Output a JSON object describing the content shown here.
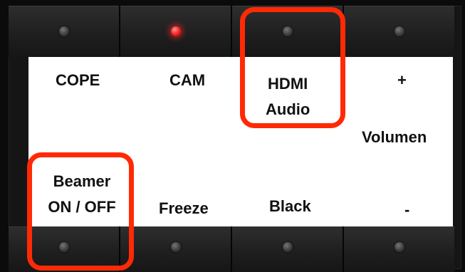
{
  "top_buttons": [
    {
      "name": "top-button-1",
      "led": "off"
    },
    {
      "name": "top-button-2",
      "led": "on"
    },
    {
      "name": "top-button-3",
      "led": "off"
    },
    {
      "name": "top-button-4",
      "led": "off"
    }
  ],
  "bottom_buttons": [
    {
      "name": "bottom-button-1",
      "led": "off"
    },
    {
      "name": "bottom-button-2",
      "led": "off"
    },
    {
      "name": "bottom-button-3",
      "led": "off"
    },
    {
      "name": "bottom-button-4",
      "led": "off"
    }
  ],
  "labels": {
    "cope": "COPE",
    "cam": "CAM",
    "hdmi_audio": [
      "HDMI",
      "Audio"
    ],
    "plus": "+",
    "volumen": "Volumen",
    "beamer": [
      "Beamer",
      "ON / OFF"
    ],
    "freeze": "Freeze",
    "black": "Black",
    "minus": "-"
  },
  "colors": {
    "highlight": "#ff2a05",
    "led_on": "#ff2a2a",
    "label_card": "#ffffff",
    "button": "#1f1f1f"
  }
}
